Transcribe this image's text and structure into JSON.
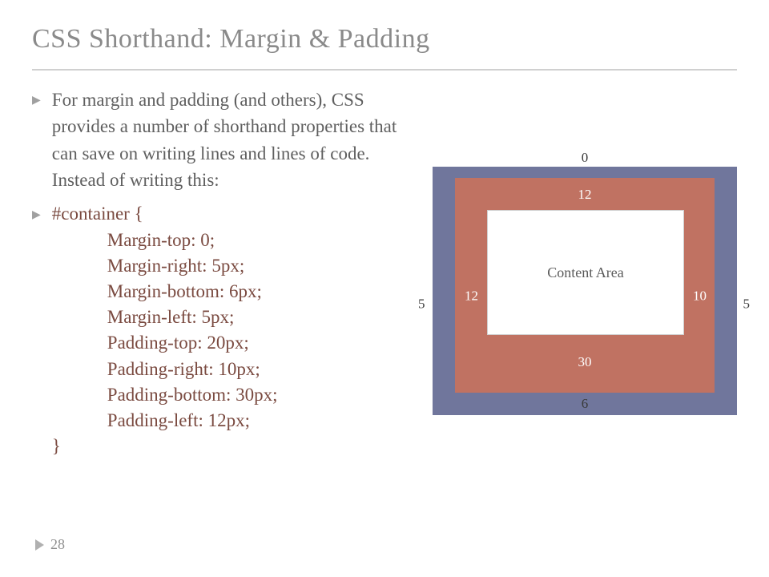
{
  "title": "CSS Shorthand: Margin & Padding",
  "intro": "For margin and padding (and others), CSS provides a number of shorthand properties that can save on writing lines and lines of code. Instead of writing this:",
  "code": {
    "open": "#container {",
    "l1": "Margin-top: 0;",
    "l2": "Margin-right: 5px;",
    "l3": "Margin-bottom: 6px;",
    "l4": "Margin-left: 5px;",
    "l5": "Padding-top: 20px;",
    "l6": "Padding-right: 10px;",
    "l7": "Padding-bottom: 30px;",
    "l8": "Padding-left: 12px;",
    "close": "}"
  },
  "diagram": {
    "margin_top": "0",
    "margin_right": "5",
    "margin_bottom": "6",
    "margin_left": "5",
    "padding_top": "12",
    "padding_right": "10",
    "padding_bottom": "30",
    "padding_left": "12",
    "content_label": "Content Area"
  },
  "page_number": "28"
}
